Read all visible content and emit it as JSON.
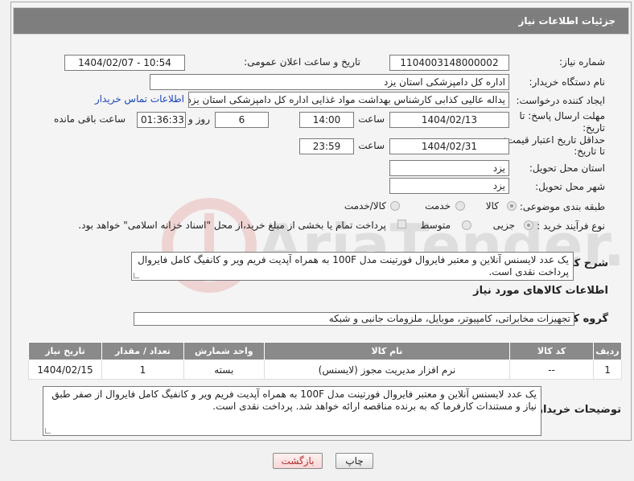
{
  "header": {
    "title": "جزئیات اطلاعات نیاز"
  },
  "fields": {
    "need_number_label": "شماره نیاز:",
    "need_number": "1104003148000002",
    "announce_label": "تاریخ و ساعت اعلان عمومی:",
    "announce_value": "1404/02/07 - 10:54",
    "buyer_label": "نام دستگاه خریدار:",
    "buyer_value": "اداره کل دامپزشکی استان یزد",
    "creator_label": "ایجاد کننده درخواست:",
    "creator_value": "یداله عالیی کذابی کارشناس بهداشت مواد غذایی اداره کل دامپزشکی استان یزد",
    "contact_link": "اطلاعات تماس خریدار",
    "deadline_label_1": "مهلت ارسال پاسخ: تا",
    "deadline_label_2": "تاریخ:",
    "deadline_date": "1404/02/13",
    "time_label": "ساعت",
    "deadline_time": "14:00",
    "days_value": "6",
    "days_label": "روز و",
    "remaining_time": "01:36:33",
    "remaining_label": "ساعت باقی مانده",
    "validity_label_1": "حداقل تاریخ اعتبار قیمت:",
    "validity_label_2": "تا تاریخ:",
    "validity_date": "1404/02/31",
    "validity_time": "23:59",
    "province_label": "استان محل تحویل:",
    "province_value": "یزد",
    "city_label": "شهر محل تحویل:",
    "city_value": "یزد",
    "category_label": "طبقه بندی موضوعی:",
    "category_options": [
      "کالا",
      "خدمت",
      "کالا/خدمت"
    ],
    "process_label": "نوع فرآیند خرید :",
    "process_options": [
      "جزیی",
      "متوسط"
    ],
    "payment_note": "پرداخت تمام یا بخشی از مبلغ خرید،از محل \"اسناد خزانه اسلامی\" خواهد بود.",
    "description_label": "شرح کلی نیاز:",
    "description_value": "یک عدد لایسنس آنلاین و معتبر فایروال فورتینت مدل 100F به همراه آپدیت فریم ویر و کانفیگ کامل فایروال پرداخت نقدی است."
  },
  "goods": {
    "section_title": "اطلاعات کالاهای مورد نیاز",
    "group_label": "گروه کالا:",
    "group_value": "تجهیزات مخابراتی، کامپیوتر، موبایل، ملزومات جانبی و شبکه",
    "table": {
      "headers": [
        "ردیف",
        "کد کالا",
        "نام کالا",
        "واحد شمارش",
        "تعداد / مقدار",
        "تاریخ نیاز"
      ],
      "rows": [
        [
          "1",
          "--",
          "نرم افزار مدیریت مجوز (لایسنس)",
          "بسته",
          "1",
          "1404/02/15"
        ]
      ]
    }
  },
  "buyer_notes": {
    "label": "توضیحات خریدار:",
    "value": "یک عدد لایسنس آنلاین و معتبر فایروال فورتینت مدل 100F به همراه آپدیت فریم ویر و کانفیگ کامل فایروال از صفر طبق نیاز و مستندات کارفرما که به برنده مناقصه ارائه خواهد شد. پرداخت نقدی است."
  },
  "buttons": {
    "print": "چاپ",
    "back": "بازگشت"
  },
  "watermark": {
    "text": "AriaTender.net"
  },
  "colors": {
    "header_bg": "#7e7e7e",
    "table_header_bg": "#8a8a8a",
    "link": "#1a47b8",
    "back_button": "#b03030"
  }
}
